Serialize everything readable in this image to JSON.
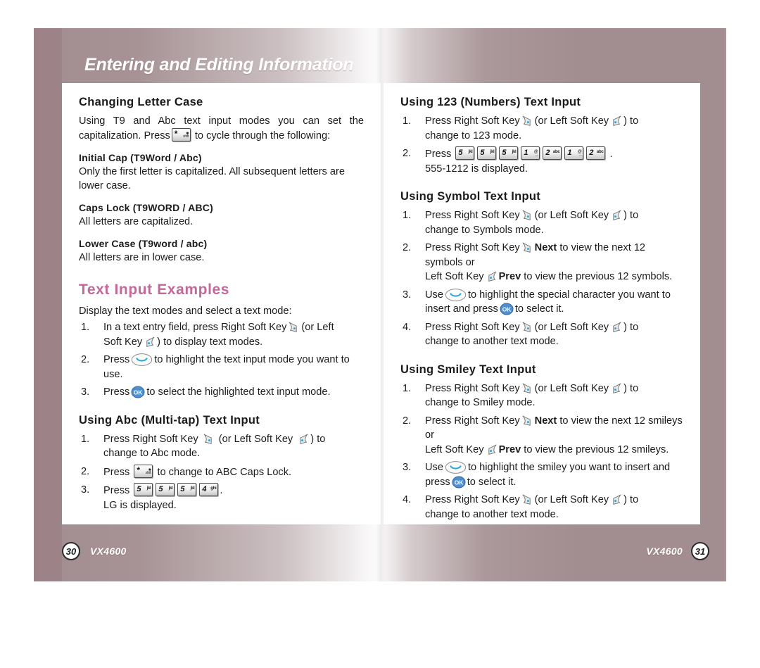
{
  "banner": {
    "title": "Entering and Editing Information"
  },
  "left_page": {
    "changing_letter_case": {
      "title": "Changing Letter Case",
      "intro_a": "Using T9 and Abc text input modes you can set the",
      "intro_b": "capitalization. Press",
      "intro_c": "to cycle through the following:",
      "items": [
        {
          "title": "Initial Cap (T9Word / Abc)",
          "body": "Only the first letter is capitalized. All subsequent letters are lower case."
        },
        {
          "title": "Caps Lock (T9WORD / ABC)",
          "body": "All letters are capitalized."
        },
        {
          "title": "Lower Case (T9word / abc)",
          "body": "All letters are in lower case."
        }
      ]
    },
    "text_input_examples": {
      "title": "Text Input Examples",
      "intro": "Display the text modes and select a text mode:",
      "steps": [
        {
          "num": "1.",
          "a": "In a text entry field, press Right Soft Key",
          "b": "(or Left",
          "c": "Soft Key",
          "d": ") to display text modes."
        },
        {
          "num": "2.",
          "a": "Press",
          "b": "to highlight the text input mode you want to use."
        },
        {
          "num": "3.",
          "a": "Press",
          "b": "to select the highlighted text input mode."
        }
      ]
    },
    "using_abc": {
      "title": "Using Abc (Multi-tap) Text Input",
      "steps": [
        {
          "num": "1.",
          "a": "Press Right Soft Key",
          "b": "(or Left Soft Key",
          "c": ") to",
          "d": "change to Abc mode."
        },
        {
          "num": "2.",
          "a": "Press",
          "b": "to change to ABC Caps Lock."
        },
        {
          "num": "3.",
          "a": "Press",
          "b": ".",
          "c": "LG is displayed."
        }
      ],
      "keys": [
        {
          "digit": "5",
          "sub": "jkl"
        },
        {
          "digit": "5",
          "sub": "jkl"
        },
        {
          "digit": "5",
          "sub": "jkl"
        },
        {
          "digit": "4",
          "sub": "ghi"
        }
      ]
    }
  },
  "right_page": {
    "using_123": {
      "title": "Using 123 (Numbers) Text Input",
      "steps": [
        {
          "num": "1.",
          "a": "Press Right Soft Key",
          "b": "(or Left Soft Key",
          "c": ") to",
          "d": "change to 123 mode."
        },
        {
          "num": "2.",
          "a": "Press",
          "b": ".",
          "c": "555-1212 is displayed."
        }
      ],
      "keys": [
        {
          "digit": "5",
          "sub": "jkl"
        },
        {
          "digit": "5",
          "sub": "jkl"
        },
        {
          "digit": "5",
          "sub": "jkl"
        },
        {
          "digit": "1",
          "sub": "@",
          "sub2": "_."
        },
        {
          "digit": "2",
          "sub": "abc"
        },
        {
          "digit": "1",
          "sub": "@",
          "sub2": "_."
        },
        {
          "digit": "2",
          "sub": "abc"
        }
      ]
    },
    "using_symbol": {
      "title": "Using Symbol Text Input",
      "steps": [
        {
          "num": "1.",
          "a": "Press Right Soft Key",
          "b": "(or Left Soft Key",
          "c": ") to",
          "d": "change to Symbols mode."
        },
        {
          "num": "2.",
          "a": "Press Right Soft Key",
          "bold": "Next",
          "b": "to view the next 12 symbols or",
          "c": "Left Soft Key",
          "bold2": "Prev",
          "d": "to view the previous 12 symbols."
        },
        {
          "num": "3.",
          "a": "Use",
          "b": "to highlight the special character you want to insert and press",
          "c": "to select it."
        },
        {
          "num": "4.",
          "a": "Press Right Soft Key",
          "b": "(or Left Soft Key",
          "c": ") to",
          "d": "change to another text mode."
        }
      ]
    },
    "using_smiley": {
      "title": "Using Smiley Text Input",
      "steps": [
        {
          "num": "1.",
          "a": "Press Right Soft Key",
          "b": "(or Left Soft Key",
          "c": ") to",
          "d": "change to Smiley mode."
        },
        {
          "num": "2.",
          "a": "Press Right Soft Key",
          "bold": "Next",
          "b": "to view the next 12 smileys or",
          "c": "Left Soft Key",
          "bold2": "Prev",
          "d": "to view the previous 12  smileys."
        },
        {
          "num": "3.",
          "a": "Use",
          "b": "to highlight the smiley you want to insert and press",
          "c": "to select it."
        },
        {
          "num": "4.",
          "a": "Press Right Soft Key",
          "b": "(or Left Soft Key",
          "c": ") to",
          "d": "change to another text mode."
        }
      ]
    }
  },
  "footer": {
    "left_page_number": "30",
    "left_model": "VX4600",
    "right_model": "VX4600",
    "right_page_number": "31"
  },
  "colors": {
    "page_background": "#a28d90",
    "left_band": "#9c8287",
    "pink_heading": "#c4679a",
    "body_text": "#1b1b1b",
    "softkey_dot": "#2aa8d8",
    "ok_key": "#4f8fd0"
  },
  "icons": {
    "star_key": "star-key-icon",
    "right_soft_key": "right-soft-key-icon",
    "left_soft_key": "left-soft-key-icon",
    "navigation_key": "navigation-key-icon",
    "ok_key": "ok-key-icon",
    "ok_label": "OK"
  }
}
